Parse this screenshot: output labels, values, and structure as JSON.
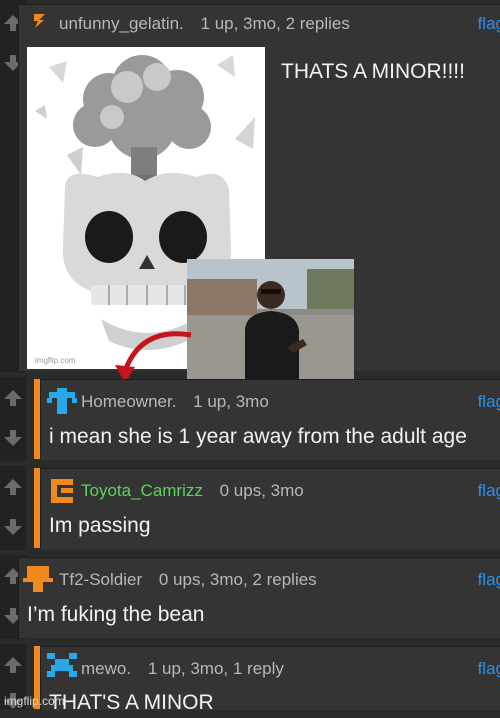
{
  "comments": [
    {
      "username": "unfunny_gelatin.",
      "stats": "1 up, 3mo, 2 replies",
      "flag": "flag",
      "text": "THATS A MINOR!!!!",
      "avatar": "gelatin-avatar-icon",
      "accent": "none"
    },
    {
      "username": "Homeowner.",
      "stats": "1 up, 3mo",
      "flag": "flag",
      "text": "i mean she is 1 year away from the adult age",
      "avatar": "homeowner-avatar-icon",
      "accent": "#f08a1c"
    },
    {
      "username": "Toyota_Camrizz",
      "stats": "0 ups, 3mo",
      "flag": "flag",
      "text": "Im passing",
      "avatar": "toyota-avatar-icon",
      "accent": "#f08a1c",
      "username_color": "#5fd35a"
    },
    {
      "username": "Tf2-Soldier",
      "stats": "0 ups, 3mo, 2 replies",
      "flag": "flag",
      "text": "I’m fuking the bean",
      "avatar": "soldier-avatar-icon",
      "accent": "none"
    },
    {
      "username": "mewo.",
      "stats": "1 up, 3mo, 1 reply",
      "flag": "flag",
      "text": "THAT'S A MINOR",
      "avatar": "mewo-avatar-icon",
      "accent": "#f08a1c"
    }
  ],
  "images": {
    "emoji_caption": "imgflip.com"
  },
  "watermark": "imgflip.com",
  "colors": {
    "flag": "#2f8fe8",
    "accent": "#f08a1c",
    "background": "#2b2b2b",
    "card": "#343434"
  }
}
